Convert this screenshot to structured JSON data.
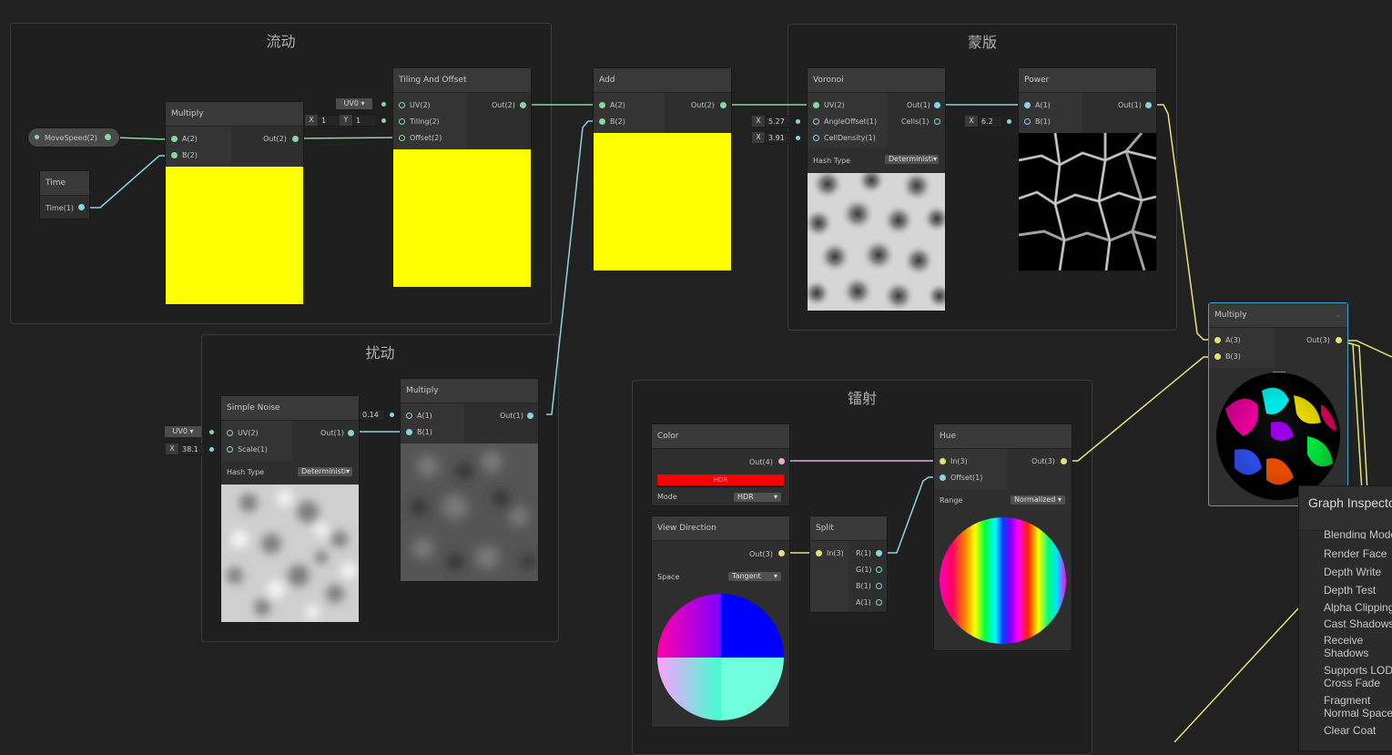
{
  "groups": {
    "flow": "流动",
    "mask": "蒙版",
    "disturb": "扰动",
    "laser": "镭射"
  },
  "property": {
    "label": "MoveSpeed(2)"
  },
  "time": {
    "title": "Time",
    "out": "Time(1)"
  },
  "multiply1": {
    "title": "Multiply",
    "a": "A(2)",
    "b": "B(2)",
    "out": "Out(2)",
    "preview_color": "#ffff00"
  },
  "tiling": {
    "title": "Tiling And Offset",
    "uv": "UV(2)",
    "tiling": "Tiling(2)",
    "offset": "Offset(2)",
    "out": "Out(2)",
    "uv_channel": "UV0",
    "tiling_x_label": "X",
    "tiling_x": "1",
    "tiling_y_label": "Y",
    "tiling_y": "1",
    "preview_color": "#ffff00"
  },
  "add": {
    "title": "Add",
    "a": "A(2)",
    "b": "B(2)",
    "out": "Out(2)",
    "preview_color": "#ffff00"
  },
  "voronoi": {
    "title": "Voronoi",
    "uv": "UV(2)",
    "angle": "AngleOffset(1)",
    "cell": "CellDensity(1)",
    "out": "Out(1)",
    "cells": "Cells(1)",
    "angle_x_label": "X",
    "angle_x": "5.27",
    "cell_x_label": "X",
    "cell_x": "3.91",
    "hash_label": "Hash Type",
    "hash_value": "Deterministi"
  },
  "power": {
    "title": "Power",
    "a": "A(1)",
    "b": "B(1)",
    "out": "Out(1)",
    "b_x_label": "X",
    "b_x": "6.2"
  },
  "multiply3": {
    "title": "Multiply",
    "a": "A(3)",
    "b": "B(3)",
    "out": "Out(3)"
  },
  "noise": {
    "title": "Simple Noise",
    "uv": "UV(2)",
    "scale": "Scale(1)",
    "out": "Out(1)",
    "uv_channel": "UV0",
    "scale_x_label": "X",
    "scale_x": "38.1",
    "hash_label": "Hash Type",
    "hash_value": "Deterministi"
  },
  "multiply2": {
    "title": "Multiply",
    "a": "A(1)",
    "b": "B(1)",
    "out": "Out(1)",
    "a_x_label": "X",
    "a_x": "0.14"
  },
  "color": {
    "title": "Color",
    "out": "Out(4)",
    "swatch": "#ff0000",
    "swatch_text": "HDR",
    "mode_label": "Mode",
    "mode_value": "HDR"
  },
  "viewdir": {
    "title": "View Direction",
    "out": "Out(3)",
    "space_label": "Space",
    "space_value": "Tangent"
  },
  "split": {
    "title": "Split",
    "in": "In(3)",
    "r": "R(1)",
    "g": "G(1)",
    "b": "B(1)",
    "a": "A(1)"
  },
  "hue": {
    "title": "Hue",
    "in": "In(3)",
    "offset": "Offset(1)",
    "out": "Out(3)",
    "range_label": "Range",
    "range_value": "Normalized"
  },
  "inspector": {
    "title": "Graph Inspector",
    "items": [
      "Blending Mode",
      "Render Face",
      "Depth Write",
      "Depth Test",
      "Alpha Clipping",
      "Cast Shadows",
      "Receive Shadows",
      "Supports LOD Cross Fade",
      "Fragment Normal Space",
      "Clear Coat"
    ]
  },
  "colors": {
    "float_wire": "#8ad4e0",
    "vec2_wire": "#8bd5a0",
    "vec3_wire": "#e6e07a",
    "vec4_wire": "#e8aad8",
    "canvas": "#212121"
  }
}
